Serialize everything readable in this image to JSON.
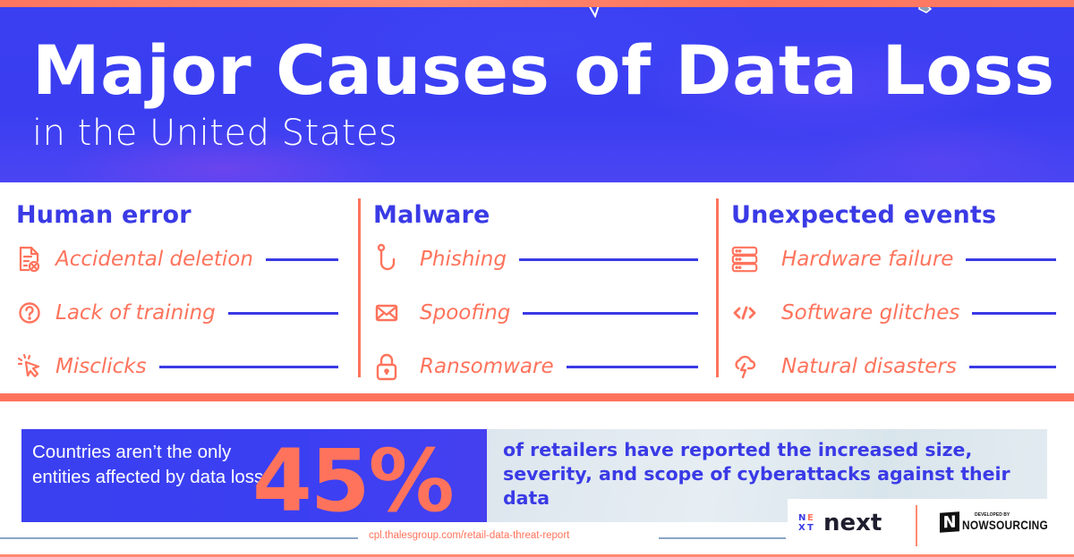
{
  "header": {
    "title": "Major Causes of Data Loss",
    "subtitle": "in the United States"
  },
  "categories": [
    {
      "heading": "Human error",
      "items": [
        {
          "label": "Accidental deletion",
          "icon": "document-delete-icon"
        },
        {
          "label": "Lack of training",
          "icon": "question-circle-icon"
        },
        {
          "label": "Misclicks",
          "icon": "cursor-click-icon"
        }
      ]
    },
    {
      "heading": "Malware",
      "items": [
        {
          "label": "Phishing",
          "icon": "fishing-hook-icon"
        },
        {
          "label": "Spoofing",
          "icon": "envelope-icon"
        },
        {
          "label": "Ransomware",
          "icon": "padlock-icon"
        }
      ]
    },
    {
      "heading": "Unexpected events",
      "items": [
        {
          "label": "Hardware failure",
          "icon": "server-icon"
        },
        {
          "label": "Software glitches",
          "icon": "code-icon"
        },
        {
          "label": "Natural disasters",
          "icon": "storm-cloud-icon"
        }
      ]
    }
  ],
  "callout": {
    "description": "Countries aren’t the only entities affected by data loss",
    "stat": "45%",
    "stat_text": "of retailers have reported the increased size, severity, and scope of cyberattacks against their data"
  },
  "source": "cpl.thalesgroup.com/retail-data-threat-report",
  "logos": {
    "next_mark": [
      "N",
      "E",
      "X",
      "T"
    ],
    "next_word": "next",
    "ns_developed_by": "DEVELOPED BY",
    "ns_mark": "N",
    "ns_name": "NOWSOURCING"
  },
  "colors": {
    "primary_blue": "#3a3ae6",
    "accent_coral": "#ff735c",
    "white": "#ffffff"
  }
}
